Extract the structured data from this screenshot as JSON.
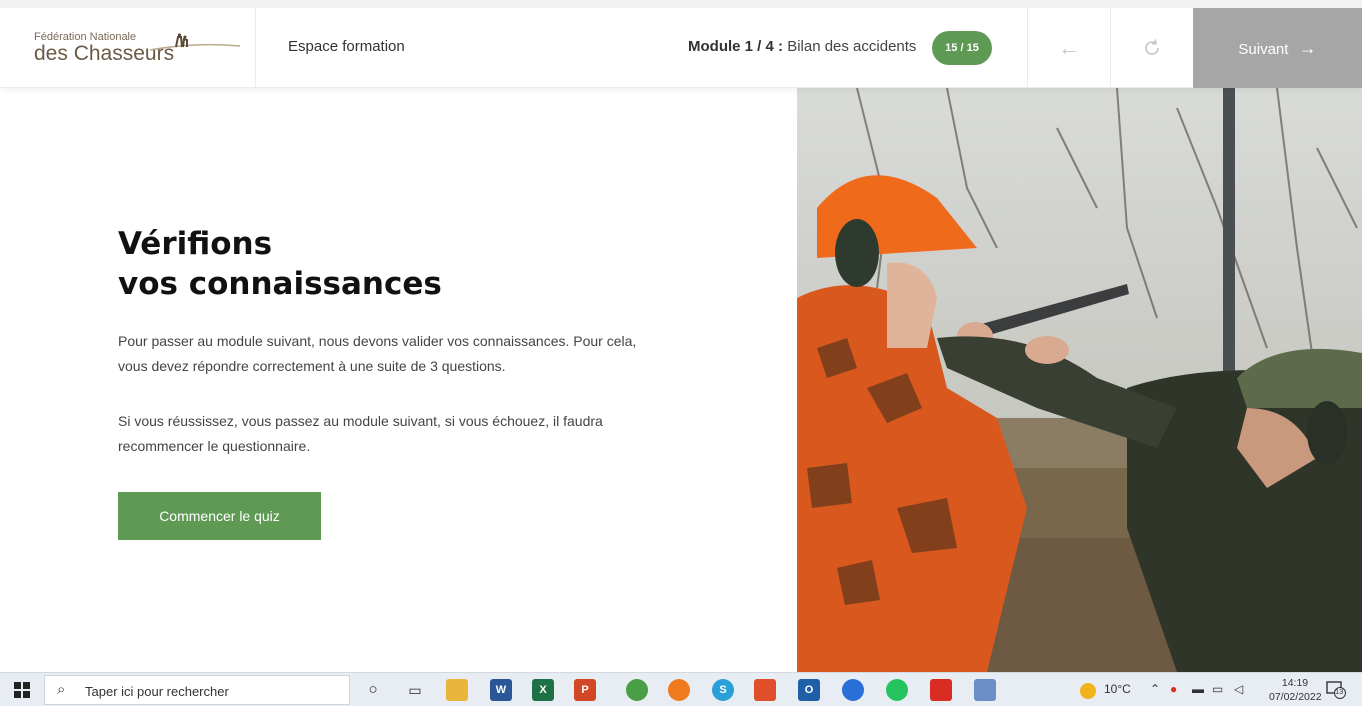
{
  "header": {
    "logo_line1": "Fédération Nationale",
    "logo_line2": "des Chasseurs",
    "espace": "Espace formation",
    "module_label": "Module 1 / 4 :",
    "module_title": "Bilan des accidents",
    "progress_badge": "15 / 15",
    "prev_icon": "arrow-left-icon",
    "reload_icon": "reload-icon",
    "next_label": "Suivant",
    "next_arrow": "→"
  },
  "content": {
    "title_line1": "Vérifions",
    "title_line2": "vos connaissances",
    "paragraph1": "Pour passer au module suivant, nous devons valider vos connaissances. Pour cela, vous devez répondre correctement à une suite de 3 questions.",
    "paragraph2": "Si vous réussissez, vous passez au module suivant, si vous échouez, il faudra recommencer le questionnaire.",
    "cta_label": "Commencer le quiz"
  },
  "taskbar": {
    "search_placeholder": "Taper ici pour rechercher",
    "weather": "10°C",
    "time": "14:19",
    "date": "07/02/2022",
    "notification_count": "13"
  },
  "colors": {
    "accent_green": "#5f9a55",
    "highlight": "#b8d23a",
    "next_button_disabled": "#a6a6a6"
  }
}
